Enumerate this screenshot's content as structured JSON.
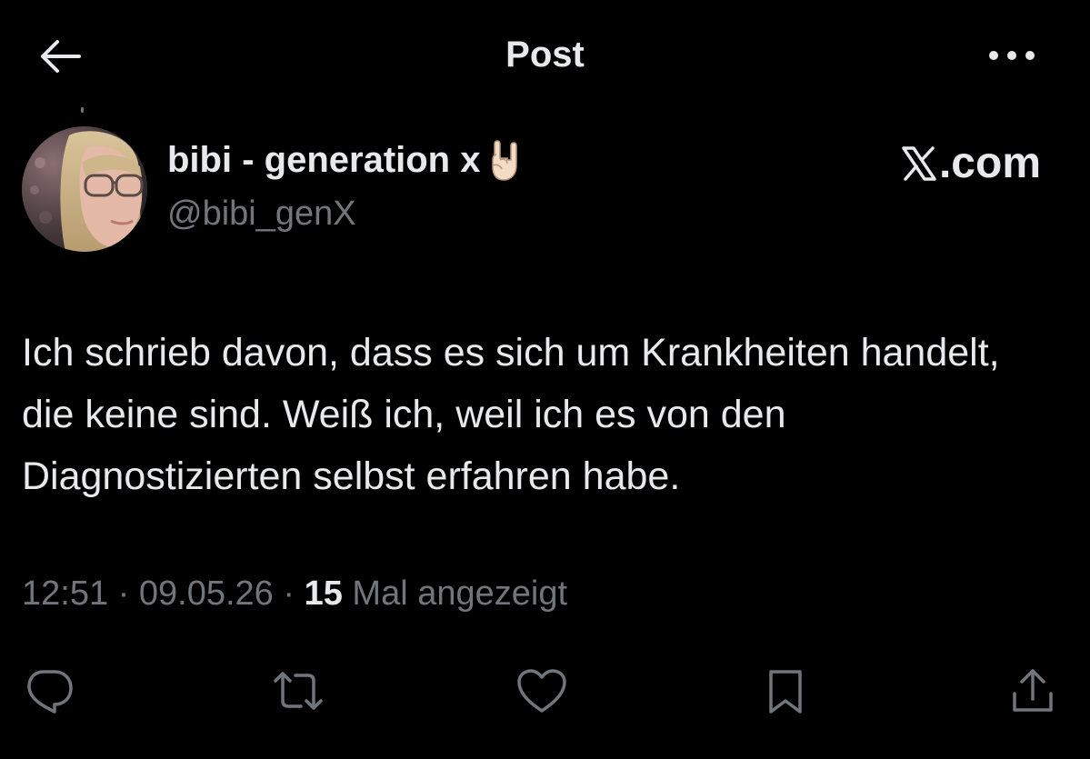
{
  "header": {
    "title": "Post",
    "back_icon": "arrow-left-icon",
    "more_icon": "more-horizontal-icon"
  },
  "author": {
    "display_name": "bibi - generation x",
    "badge_icon": "sign-of-horns-emoji",
    "handle": "@bibi_genX"
  },
  "brand": {
    "label": ".com",
    "icon": "x-logo-icon"
  },
  "post": {
    "text": "Ich schrieb davon, dass es sich um Krankheiten handelt, die keine sind. Weiß ich, weil ich es von den Diagnostizierten selbst erfahren habe."
  },
  "meta": {
    "time": "12:51",
    "separator": " · ",
    "date": "09.05.26",
    "views_count": "15",
    "views_label": " Mal angezeigt"
  },
  "actions": [
    {
      "name": "reply",
      "icon": "reply-icon"
    },
    {
      "name": "repost",
      "icon": "repost-icon"
    },
    {
      "name": "like",
      "icon": "heart-icon"
    },
    {
      "name": "bookmark",
      "icon": "bookmark-icon"
    },
    {
      "name": "share",
      "icon": "share-icon"
    }
  ],
  "colors": {
    "background": "#000000",
    "primary_text": "#e7e9ea",
    "secondary_text": "#71767b"
  }
}
